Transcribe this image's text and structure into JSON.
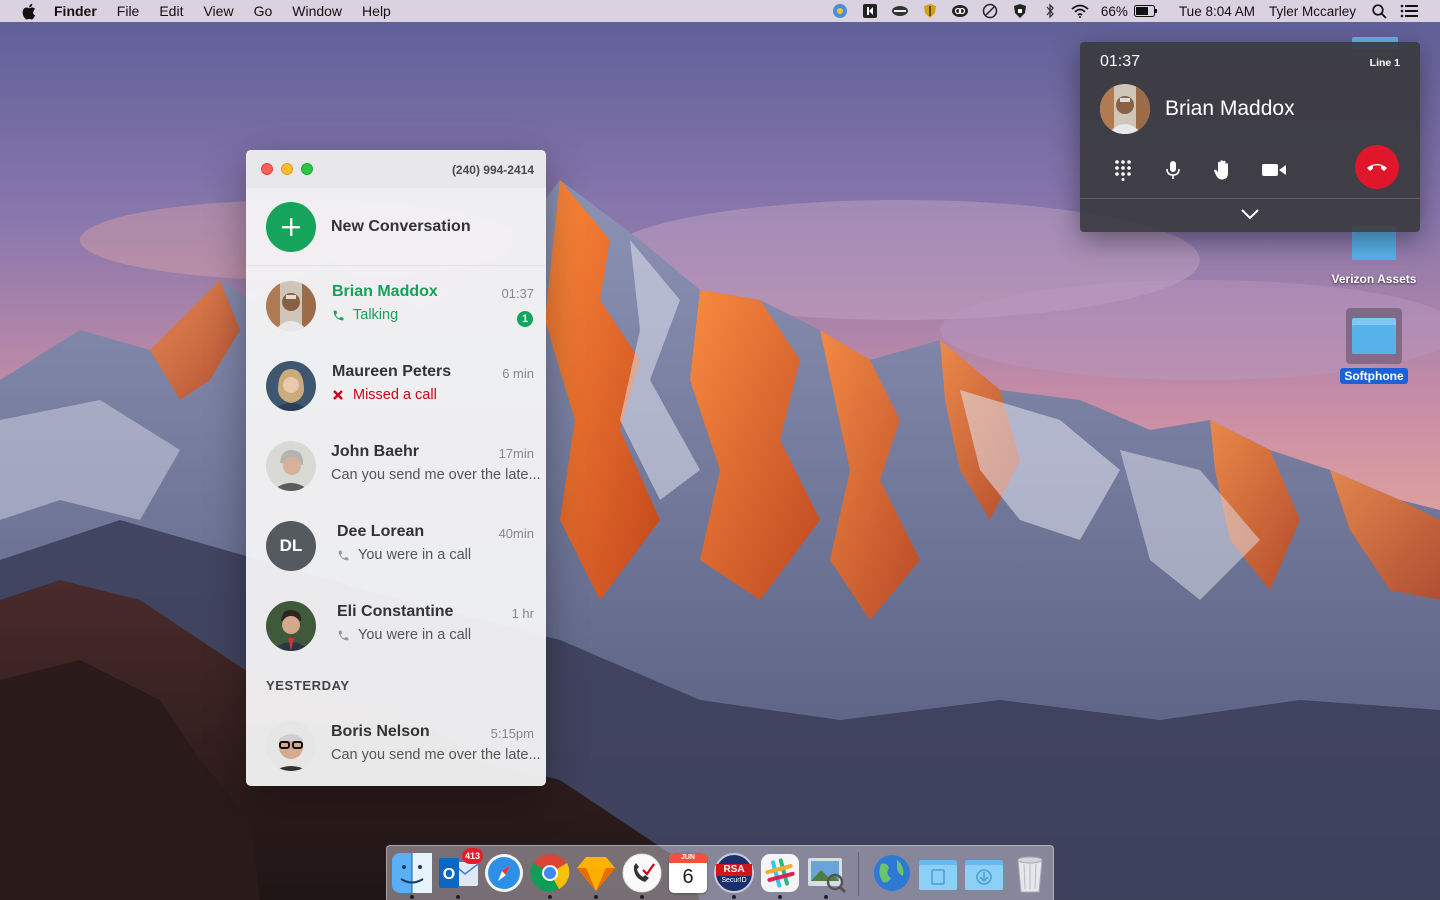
{
  "menubar": {
    "app_name": "Finder",
    "items": [
      "File",
      "Edit",
      "View",
      "Go",
      "Window",
      "Help"
    ],
    "battery": "66%",
    "clock": "Tue 8:04 AM",
    "user": "Tyler Mccarley"
  },
  "phone_window": {
    "number": "(240) 994-2414",
    "new_conversation_label": "New Conversation",
    "conversations": [
      {
        "name": "Brian Maddox",
        "time": "01:37",
        "status": "Talking",
        "badge": "1"
      },
      {
        "name": "Maureen Peters",
        "time": "6 min",
        "status": "Missed a call"
      },
      {
        "name": "John Baehr",
        "time": "17min",
        "status": "Can you send me over the late..."
      },
      {
        "name": "Dee Lorean",
        "initials": "DL",
        "time": "40min",
        "status": "You were in a call"
      },
      {
        "name": "Eli Constantine",
        "time": "1 hr",
        "status": "You were in a call"
      }
    ],
    "section_yesterday": "YESTERDAY",
    "yesterday": [
      {
        "name": "Boris Nelson",
        "time": "5:15pm",
        "status": "Can you send me over the late..."
      }
    ]
  },
  "call_panel": {
    "timer": "01:37",
    "line": "Line 1",
    "caller": "Brian Maddox"
  },
  "desktop": {
    "icons": [
      {
        "label": "Verizon Assets"
      },
      {
        "label": "Softphone"
      }
    ]
  },
  "dock": {
    "outlook_badge": "413",
    "calendar_month": "JUN",
    "calendar_day": "6",
    "rsa_label": "RSA",
    "rsa_sub": "SecurID"
  },
  "colors": {
    "accent_green": "#16a35c",
    "missed_red": "#d0021b",
    "hangup_red": "#e0162b",
    "selection_blue": "#1a62d6"
  }
}
